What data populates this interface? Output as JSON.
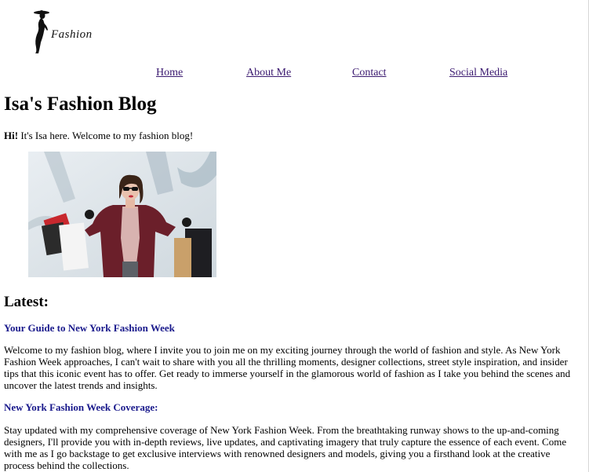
{
  "logo": {
    "text": "Fashion"
  },
  "nav": {
    "items": [
      {
        "label": "Home"
      },
      {
        "label": "About Me"
      },
      {
        "label": "Contact"
      },
      {
        "label": "Social Media"
      }
    ]
  },
  "page": {
    "title": "Isa's Fashion Blog",
    "intro_bold": "Hi!",
    "intro_text": " It's Isa here. Welcome to my fashion blog!"
  },
  "latest": {
    "heading": "Latest:",
    "posts": [
      {
        "title": "Your Guide to New York Fashion Week",
        "body": "Welcome to my fashion blog, where I invite you to join me on my exciting journey through the world of fashion and style. As New York Fashion Week approaches, I can't wait to share with you all the thrilling moments, designer collections, street style inspiration, and insider tips that this iconic event has to offer. Get ready to immerse yourself in the glamorous world of fashion as I take you behind the scenes and uncover the latest trends and insights."
      },
      {
        "title": "New York Fashion Week Coverage:",
        "body": "Stay updated with my comprehensive coverage of New York Fashion Week. From the breathtaking runway shows to the up-and-coming designers, I'll provide you with in-depth reviews, live updates, and captivating imagery that truly capture the essence of each event. Come with me as I go backstage to get exclusive interviews with renowned designers and models, giving you a firsthand look at the creative process behind the collections."
      }
    ]
  },
  "colors": {
    "link": "#3b1a70",
    "post_title": "#1a1a8c",
    "coat": "#6b1f2a"
  }
}
